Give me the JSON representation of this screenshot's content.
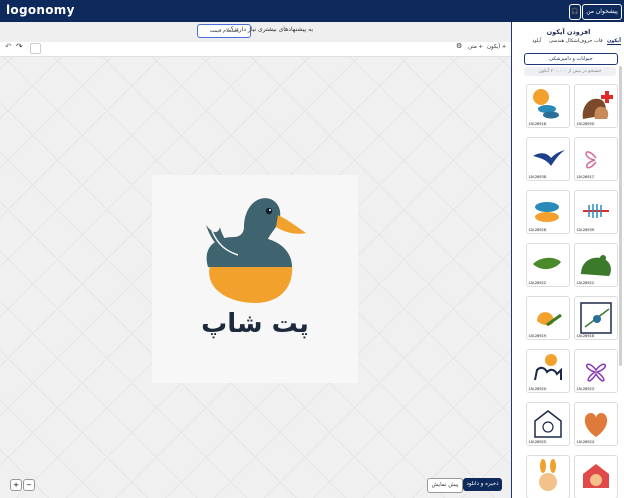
{
  "app": {
    "logo_text": "logonomy"
  },
  "topbar": {
    "dashboard_label": "پیشخوان من"
  },
  "hint": {
    "question": "به پیشنهادهای بیشتری نیاز دارید؟",
    "button_label": "استعلام قیمت"
  },
  "toolbar": {
    "icon_label": "آیکون",
    "text_label": "متن"
  },
  "canvas": {
    "brand_text": "پت شاپ"
  },
  "actions": {
    "save_label": "ذخیره و دانلود",
    "preview_label": "پیش نمایش"
  },
  "panel": {
    "title": "افزودن آیکون",
    "tabs": [
      {
        "label": "آیکون",
        "active": true
      },
      {
        "label": "قاب",
        "active": false
      },
      {
        "label": "حروف",
        "active": false
      },
      {
        "label": "اشکال هندسی",
        "active": false
      },
      {
        "label": "آپلود",
        "active": false
      }
    ],
    "category": "حیوانات و دامپزشکی",
    "search_placeholder": "جستجو در بیش از ۲۰۰,۰۰۰ آیکون",
    "icons": [
      {
        "code": "LN-26950",
        "name": "dog-cat-vet-icon"
      },
      {
        "code": "LN-26916",
        "name": "fish-sun-icon"
      },
      {
        "code": "LN-26917",
        "name": "butterfly-line-icon"
      },
      {
        "code": "LN-26938",
        "name": "bird-wings-icon"
      },
      {
        "code": "LN-26939",
        "name": "fish-skeleton-icon"
      },
      {
        "code": "LN-26926",
        "name": "fish-pair-icon"
      },
      {
        "code": "LN-26921",
        "name": "frog-icon"
      },
      {
        "code": "LN-26922",
        "name": "bass-fish-icon"
      },
      {
        "code": "LN-26918",
        "name": "bird-branch-icon"
      },
      {
        "code": "LN-26919",
        "name": "bird-leaf-icon"
      },
      {
        "code": "LN-26923",
        "name": "butterfly-purple-icon"
      },
      {
        "code": "LN-26920",
        "name": "camel-icon"
      },
      {
        "code": "LN-26924",
        "name": "pets-heart-icon"
      },
      {
        "code": "LN-26925",
        "name": "cat-house-icon"
      },
      {
        "code": "",
        "name": "pet-home-icon"
      },
      {
        "code": "",
        "name": "bunny-icon"
      }
    ]
  },
  "colors": {
    "navy": "#0e2a5c",
    "duck_body": "#3f6470",
    "duck_belly": "#f2a22c",
    "beak": "#f2a22c"
  }
}
